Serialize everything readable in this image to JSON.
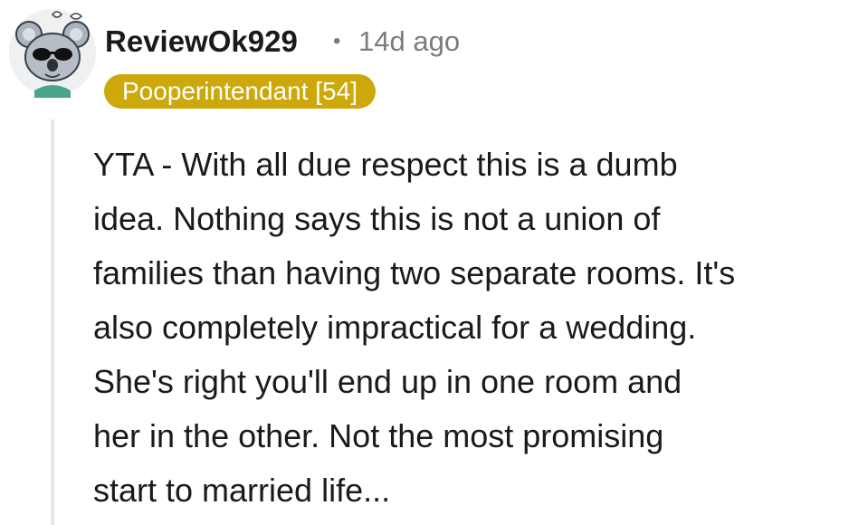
{
  "comment": {
    "author": "ReviewOk929",
    "separator": "•",
    "timestamp": "14d ago",
    "flair": "Pooperintendant [54]",
    "body": "YTA - With all due respect this is a dumb\nidea. Nothing says this is not a union of\nfamilies than having two separate rooms. It's\nalso completely impractical for a wedding.\nShe's right you'll end up in one room and\nher in the other. Not the most promising\nstart to married life...",
    "flair_color": "#cca80a",
    "avatar_icon": "koala-avatar-icon"
  }
}
